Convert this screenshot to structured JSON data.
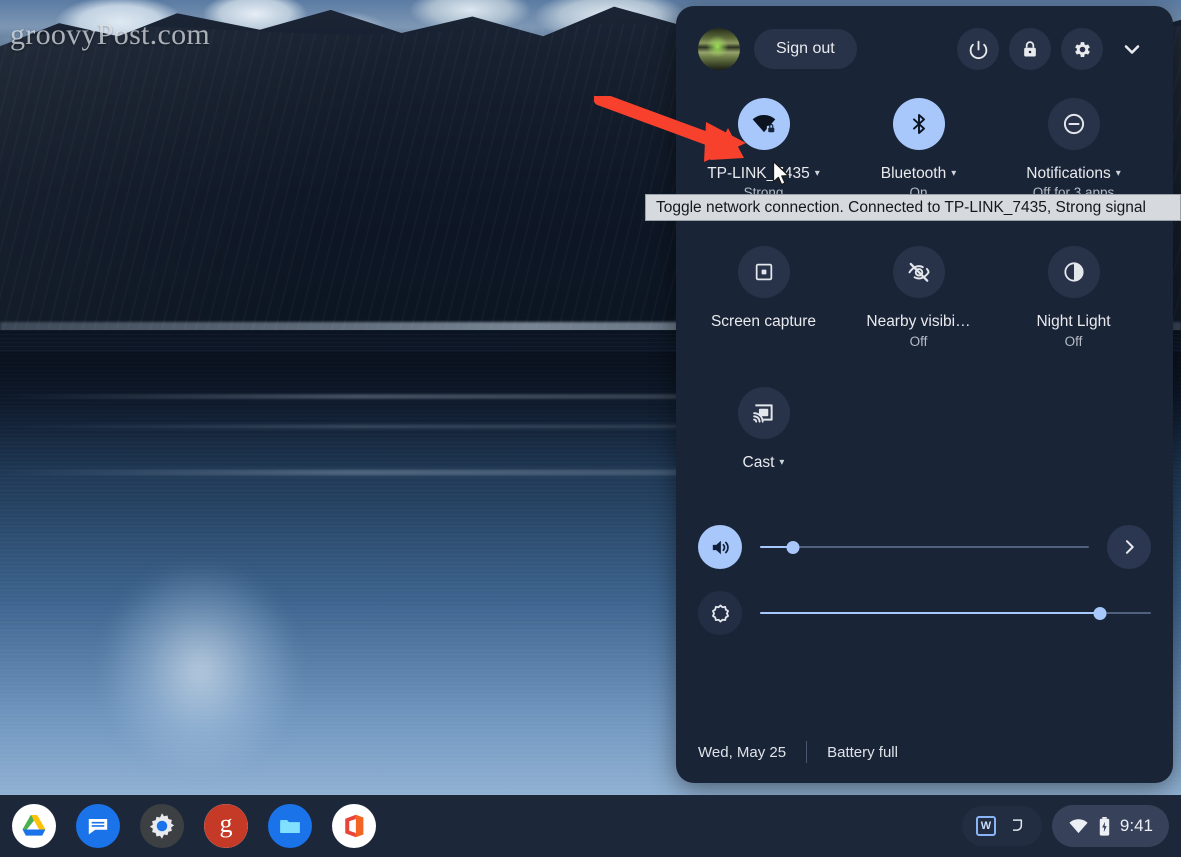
{
  "desktop": {
    "watermark": "groovyPost.com",
    "wallpaper_name": "moonlit-mountain-lake"
  },
  "panel": {
    "header": {
      "avatar_name": "user-avatar",
      "sign_out_label": "Sign out",
      "power_icon": "power-icon",
      "lock_icon": "lock-icon",
      "settings_icon": "gear-icon",
      "collapse_icon": "chevron-down-icon"
    },
    "tiles": [
      {
        "id": "network",
        "icon": "wifi-locked-icon",
        "label": "TP-LINK_7435",
        "sub": "Strong",
        "state": "on",
        "has_caret": true
      },
      {
        "id": "bluetooth",
        "icon": "bluetooth-icon",
        "label": "Bluetooth",
        "sub": "On",
        "state": "on",
        "has_caret": true
      },
      {
        "id": "notifications",
        "icon": "do-not-disturb-icon",
        "label": "Notifications",
        "sub": "Off for 3 apps",
        "state": "off",
        "has_caret": true
      },
      {
        "id": "screen-capture",
        "icon": "screen-capture-icon",
        "label": "Screen capture",
        "sub": "",
        "state": "off",
        "has_caret": false
      },
      {
        "id": "nearby-visibility",
        "icon": "eye-off-icon",
        "label": "Nearby visibi…",
        "sub": "Off",
        "state": "off",
        "has_caret": false
      },
      {
        "id": "night-light",
        "icon": "night-light-icon",
        "label": "Night Light",
        "sub": "Off",
        "state": "off",
        "has_caret": false
      },
      {
        "id": "cast",
        "icon": "cast-icon",
        "label": "Cast",
        "sub": "",
        "state": "off",
        "has_caret": true
      }
    ],
    "sliders": {
      "volume": {
        "icon": "volume-up-icon",
        "value": 10,
        "expand_icon": "chevron-right-icon"
      },
      "brightness": {
        "icon": "brightness-icon",
        "value": 87
      }
    },
    "footer": {
      "date": "Wed, May 25",
      "battery": "Battery full"
    }
  },
  "tooltip": {
    "text": "Toggle network connection. Connected to TP-LINK_7435, Strong signal"
  },
  "annotation": {
    "arrow_color": "#f8412d",
    "arrow_name": "red-pointer-arrow"
  },
  "shelf": {
    "apps": [
      {
        "id": "drive",
        "name": "google-drive-app-icon",
        "running": false
      },
      {
        "id": "messages",
        "name": "messages-app-icon",
        "running": false
      },
      {
        "id": "settings",
        "name": "settings-app-icon",
        "running": false
      },
      {
        "id": "groovy",
        "name": "groovypost-app-icon",
        "running": false
      },
      {
        "id": "files",
        "name": "files-app-icon",
        "running": true
      },
      {
        "id": "office",
        "name": "office-app-icon",
        "running": false
      }
    ],
    "tray": {
      "ime_label": "W",
      "ime_icon": "stylus-icon",
      "wifi_icon": "wifi-icon",
      "battery_icon": "battery-full-icon",
      "clock": "9:41"
    }
  },
  "colors": {
    "panel_bg": "#1a2437",
    "tile_on": "#a8c7fa",
    "tile_off": "#28334a",
    "accent": "#8ab4f8",
    "shelf_bg": "#1c2739",
    "tooltip_bg": "#d6d9de"
  }
}
